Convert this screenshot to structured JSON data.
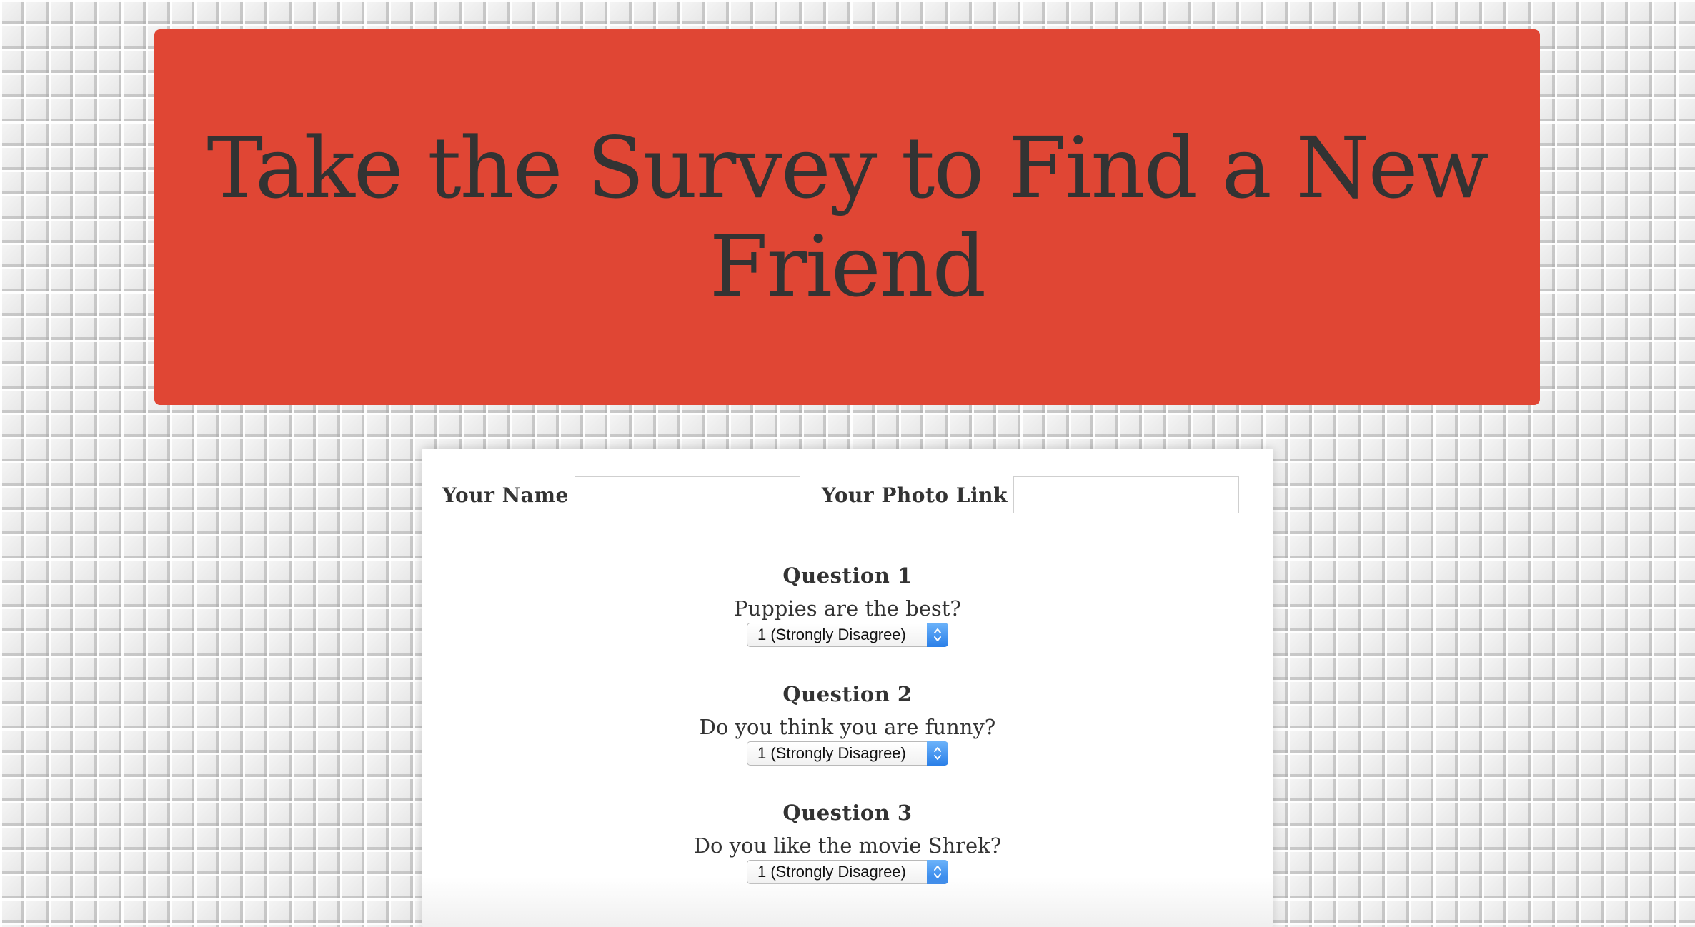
{
  "header": {
    "title": "Take the Survey to Find a New Friend"
  },
  "form": {
    "name_label": "Your Name",
    "name_value": "",
    "photo_label": "Your Photo Link",
    "photo_value": ""
  },
  "questions": [
    {
      "title": "Question 1",
      "text": "Puppies are the best?",
      "selected": "1 (Strongly Disagree)"
    },
    {
      "title": "Question 2",
      "text": "Do you think you are funny?",
      "selected": "1 (Strongly Disagree)"
    },
    {
      "title": "Question 3",
      "text": "Do you like the movie Shrek?",
      "selected": "1 (Strongly Disagree)"
    }
  ],
  "colors": {
    "header_background": "#e04634",
    "text": "#333333",
    "select_accent": "#2a7fe8"
  },
  "icons": {
    "select_arrows": "up-down-chevron-icon"
  }
}
